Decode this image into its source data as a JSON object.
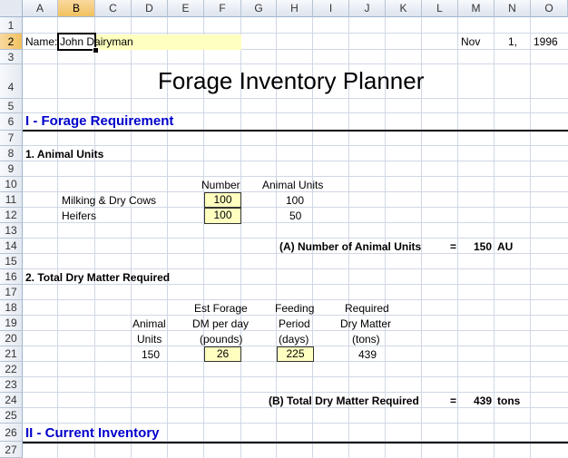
{
  "columns": [
    "A",
    "B",
    "C",
    "D",
    "E",
    "F",
    "G",
    "H",
    "I",
    "J",
    "K",
    "L",
    "M",
    "N",
    "O"
  ],
  "rows": [
    "1",
    "2",
    "3",
    "4",
    "5",
    "6",
    "7",
    "8",
    "9",
    "10",
    "11",
    "12",
    "13",
    "14",
    "15",
    "16",
    "17",
    "18",
    "19",
    "20",
    "21",
    "22",
    "23",
    "24",
    "25",
    "26",
    "27"
  ],
  "selected_column": "B",
  "selected_row": "2",
  "header": {
    "name_label": "Name:",
    "name_value": "John Dairyman",
    "date_month": "Nov",
    "date_day": "1,",
    "date_year": "1996"
  },
  "title": "Forage Inventory Planner",
  "section1": {
    "title": "I - Forage Requirement",
    "animal_units": {
      "heading": "1.  Animal Units",
      "col_number": "Number",
      "col_animal_units": "Animal Units",
      "rows": [
        {
          "label": "Milking & Dry Cows",
          "number": "100",
          "units": "100"
        },
        {
          "label": "Heifers",
          "number": "100",
          "units": "50"
        }
      ],
      "total_label": "(A)  Number of Animal Units",
      "equals": "=",
      "total_value": "150",
      "total_unit": "AU"
    },
    "dry_matter": {
      "heading": "2.  Total Dry Matter Required",
      "hdr_animal_1": "Animal",
      "hdr_animal_2": "Units",
      "hdr_forage_1": "Est Forage",
      "hdr_forage_2": "DM per day",
      "hdr_forage_3": "(pounds)",
      "hdr_period_1": "Feeding",
      "hdr_period_2": "Period",
      "hdr_period_3": "(days)",
      "hdr_req_1": "Required",
      "hdr_req_2": "Dry Matter",
      "hdr_req_3": "(tons)",
      "animal_units": "150",
      "forage_per_day": "26",
      "feeding_period": "225",
      "required_dm": "439",
      "total_label": "(B)  Total Dry Matter Required",
      "equals": "=",
      "total_value": "439",
      "total_unit": "tons"
    }
  },
  "section2": {
    "title": "II - Current Inventory"
  },
  "colors": {
    "input_fill": "#ffffc0",
    "section_title": "#0000cc",
    "selected_header": "#f1c15f"
  }
}
